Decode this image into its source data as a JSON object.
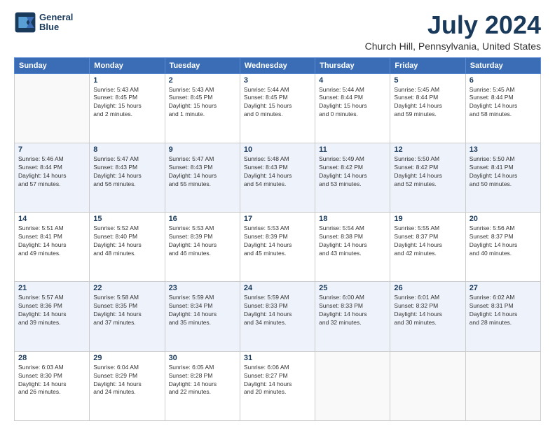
{
  "header": {
    "logo_line1": "General",
    "logo_line2": "Blue",
    "title": "July 2024",
    "subtitle": "Church Hill, Pennsylvania, United States"
  },
  "days_of_week": [
    "Sunday",
    "Monday",
    "Tuesday",
    "Wednesday",
    "Thursday",
    "Friday",
    "Saturday"
  ],
  "weeks": [
    [
      {
        "num": "",
        "info": ""
      },
      {
        "num": "1",
        "info": "Sunrise: 5:43 AM\nSunset: 8:45 PM\nDaylight: 15 hours\nand 2 minutes."
      },
      {
        "num": "2",
        "info": "Sunrise: 5:43 AM\nSunset: 8:45 PM\nDaylight: 15 hours\nand 1 minute."
      },
      {
        "num": "3",
        "info": "Sunrise: 5:44 AM\nSunset: 8:45 PM\nDaylight: 15 hours\nand 0 minutes."
      },
      {
        "num": "4",
        "info": "Sunrise: 5:44 AM\nSunset: 8:44 PM\nDaylight: 15 hours\nand 0 minutes."
      },
      {
        "num": "5",
        "info": "Sunrise: 5:45 AM\nSunset: 8:44 PM\nDaylight: 14 hours\nand 59 minutes."
      },
      {
        "num": "6",
        "info": "Sunrise: 5:45 AM\nSunset: 8:44 PM\nDaylight: 14 hours\nand 58 minutes."
      }
    ],
    [
      {
        "num": "7",
        "info": "Sunrise: 5:46 AM\nSunset: 8:44 PM\nDaylight: 14 hours\nand 57 minutes."
      },
      {
        "num": "8",
        "info": "Sunrise: 5:47 AM\nSunset: 8:43 PM\nDaylight: 14 hours\nand 56 minutes."
      },
      {
        "num": "9",
        "info": "Sunrise: 5:47 AM\nSunset: 8:43 PM\nDaylight: 14 hours\nand 55 minutes."
      },
      {
        "num": "10",
        "info": "Sunrise: 5:48 AM\nSunset: 8:43 PM\nDaylight: 14 hours\nand 54 minutes."
      },
      {
        "num": "11",
        "info": "Sunrise: 5:49 AM\nSunset: 8:42 PM\nDaylight: 14 hours\nand 53 minutes."
      },
      {
        "num": "12",
        "info": "Sunrise: 5:50 AM\nSunset: 8:42 PM\nDaylight: 14 hours\nand 52 minutes."
      },
      {
        "num": "13",
        "info": "Sunrise: 5:50 AM\nSunset: 8:41 PM\nDaylight: 14 hours\nand 50 minutes."
      }
    ],
    [
      {
        "num": "14",
        "info": "Sunrise: 5:51 AM\nSunset: 8:41 PM\nDaylight: 14 hours\nand 49 minutes."
      },
      {
        "num": "15",
        "info": "Sunrise: 5:52 AM\nSunset: 8:40 PM\nDaylight: 14 hours\nand 48 minutes."
      },
      {
        "num": "16",
        "info": "Sunrise: 5:53 AM\nSunset: 8:39 PM\nDaylight: 14 hours\nand 46 minutes."
      },
      {
        "num": "17",
        "info": "Sunrise: 5:53 AM\nSunset: 8:39 PM\nDaylight: 14 hours\nand 45 minutes."
      },
      {
        "num": "18",
        "info": "Sunrise: 5:54 AM\nSunset: 8:38 PM\nDaylight: 14 hours\nand 43 minutes."
      },
      {
        "num": "19",
        "info": "Sunrise: 5:55 AM\nSunset: 8:37 PM\nDaylight: 14 hours\nand 42 minutes."
      },
      {
        "num": "20",
        "info": "Sunrise: 5:56 AM\nSunset: 8:37 PM\nDaylight: 14 hours\nand 40 minutes."
      }
    ],
    [
      {
        "num": "21",
        "info": "Sunrise: 5:57 AM\nSunset: 8:36 PM\nDaylight: 14 hours\nand 39 minutes."
      },
      {
        "num": "22",
        "info": "Sunrise: 5:58 AM\nSunset: 8:35 PM\nDaylight: 14 hours\nand 37 minutes."
      },
      {
        "num": "23",
        "info": "Sunrise: 5:59 AM\nSunset: 8:34 PM\nDaylight: 14 hours\nand 35 minutes."
      },
      {
        "num": "24",
        "info": "Sunrise: 5:59 AM\nSunset: 8:33 PM\nDaylight: 14 hours\nand 34 minutes."
      },
      {
        "num": "25",
        "info": "Sunrise: 6:00 AM\nSunset: 8:33 PM\nDaylight: 14 hours\nand 32 minutes."
      },
      {
        "num": "26",
        "info": "Sunrise: 6:01 AM\nSunset: 8:32 PM\nDaylight: 14 hours\nand 30 minutes."
      },
      {
        "num": "27",
        "info": "Sunrise: 6:02 AM\nSunset: 8:31 PM\nDaylight: 14 hours\nand 28 minutes."
      }
    ],
    [
      {
        "num": "28",
        "info": "Sunrise: 6:03 AM\nSunset: 8:30 PM\nDaylight: 14 hours\nand 26 minutes."
      },
      {
        "num": "29",
        "info": "Sunrise: 6:04 AM\nSunset: 8:29 PM\nDaylight: 14 hours\nand 24 minutes."
      },
      {
        "num": "30",
        "info": "Sunrise: 6:05 AM\nSunset: 8:28 PM\nDaylight: 14 hours\nand 22 minutes."
      },
      {
        "num": "31",
        "info": "Sunrise: 6:06 AM\nSunset: 8:27 PM\nDaylight: 14 hours\nand 20 minutes."
      },
      {
        "num": "",
        "info": ""
      },
      {
        "num": "",
        "info": ""
      },
      {
        "num": "",
        "info": ""
      }
    ]
  ]
}
